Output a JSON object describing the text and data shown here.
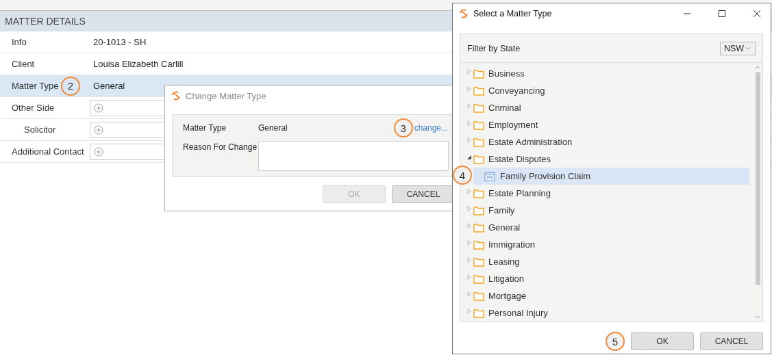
{
  "matter_details": {
    "title": "MATTER DETAILS",
    "rows": [
      {
        "label": "Info",
        "value": "20-1013 - SH",
        "kind": "text",
        "selected": false
      },
      {
        "label": "Client",
        "value": "Louisa Elizabeth Carlill",
        "kind": "text",
        "selected": false
      },
      {
        "label": "Matter Type",
        "value": "General",
        "kind": "text",
        "selected": true,
        "badge": "2"
      },
      {
        "label": "Other Side",
        "kind": "contact",
        "selected": false,
        "children": [
          {
            "label": "Solicitor",
            "kind": "contact",
            "selected": false
          }
        ]
      },
      {
        "label": "Additional Contact",
        "kind": "contact",
        "selected": false
      }
    ]
  },
  "change_dialog": {
    "title": "Change Matter Type",
    "matter_type_label": "Matter Type",
    "matter_type_value": "General",
    "change_link": "change...",
    "link_badge": "3",
    "reason_label": "Reason For Change",
    "buttons": [
      {
        "label": "OK",
        "disabled": true
      },
      {
        "label": "CANCEL",
        "disabled": false
      }
    ]
  },
  "select_dialog": {
    "title": "Select a Matter Type",
    "filter_label": "Filter by State",
    "state": "NSW",
    "tree": [
      {
        "label": "Business",
        "expanded": false,
        "selected": false
      },
      {
        "label": "Conveyancing",
        "expanded": false,
        "selected": false
      },
      {
        "label": "Criminal",
        "expanded": false,
        "selected": false
      },
      {
        "label": "Employment",
        "expanded": false,
        "selected": false
      },
      {
        "label": "Estate Administration",
        "expanded": false,
        "selected": false
      },
      {
        "label": "Estate Disputes",
        "expanded": true,
        "selected": false,
        "children": [
          {
            "label": "Family Provision Claim",
            "selected": true,
            "badge": "4"
          }
        ]
      },
      {
        "label": "Estate Planning",
        "expanded": false,
        "selected": false
      },
      {
        "label": "Family",
        "expanded": false,
        "selected": false
      },
      {
        "label": "General",
        "expanded": false,
        "selected": false
      },
      {
        "label": "Immigration",
        "expanded": false,
        "selected": false
      },
      {
        "label": "Leasing",
        "expanded": false,
        "selected": false
      },
      {
        "label": "Litigation",
        "expanded": false,
        "selected": false
      },
      {
        "label": "Mortgage",
        "expanded": false,
        "selected": false
      },
      {
        "label": "Personal Injury",
        "expanded": false,
        "selected": false
      }
    ],
    "ok_badge": "5",
    "buttons": [
      {
        "label": "OK",
        "disabled": false
      },
      {
        "label": "CANCEL",
        "disabled": false
      }
    ]
  }
}
